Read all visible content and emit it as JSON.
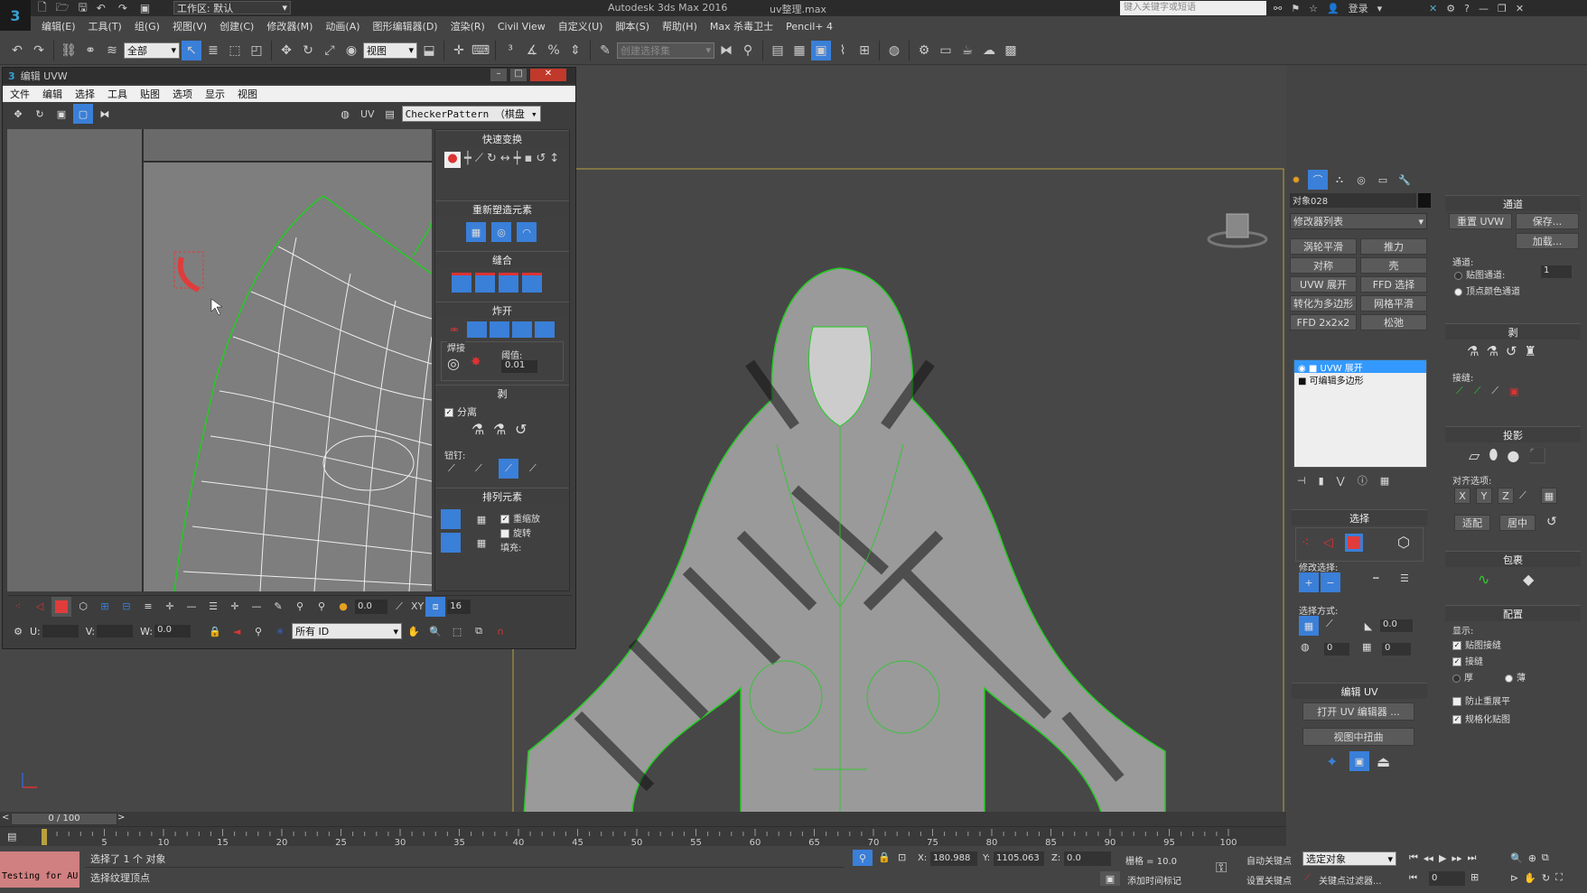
{
  "title_bar": {
    "workspace": "工作区: 默认",
    "app_title": "Autodesk 3ds Max 2016",
    "file_name": "uv整理.max",
    "search_placeholder": "键入关键字或短语",
    "login": "登录"
  },
  "main_menu": [
    "编辑(E)",
    "工具(T)",
    "组(G)",
    "视图(V)",
    "创建(C)",
    "修改器(M)",
    "动画(A)",
    "图形编辑器(D)",
    "渲染(R)",
    "Civil View",
    "自定义(U)",
    "脚本(S)",
    "帮助(H)",
    "Max 杀毒卫士",
    "Pencil+ 4"
  ],
  "toolbar": {
    "filter": "全部",
    "ref_coord": "视图",
    "selection_set": "创建选择集"
  },
  "uvw_editor": {
    "title": "编辑 UVW",
    "menu": [
      "文件",
      "编辑",
      "选择",
      "工具",
      "贴图",
      "选项",
      "显示",
      "视图"
    ],
    "uv_label": "UV",
    "texture": "CheckerPattern （棋盘",
    "rollouts": {
      "quick_transform": "快速变换",
      "reshape": "重新塑造元素",
      "stitch": "缝合",
      "explode": "炸开",
      "weld": "焊接",
      "threshold_label": "阈值:",
      "threshold": "0.01",
      "peel": "剥",
      "detach": "分离",
      "pin": "钮钉:",
      "arrange": "排列元素",
      "rescale": "重缩放",
      "rotate": "旋转",
      "padding": "填充:"
    },
    "bottom": {
      "value1": "0.0",
      "xy": "XY",
      "num": "16",
      "u_label": "U:",
      "v_label": "V:",
      "w_label": "W:",
      "w_value": "0.0",
      "id_filter": "所有 ID"
    }
  },
  "command_panel": {
    "object_name": "对象028",
    "modifier_list": "修改器列表",
    "modifier_buttons": [
      "涡轮平滑",
      "推力",
      "对称",
      "壳",
      "UVW 展开",
      "FFD 选择",
      "转化为多边形",
      "网格平滑",
      "FFD 2x2x2",
      "松弛"
    ],
    "stack": [
      "UVW 展开",
      "可编辑多边形"
    ],
    "select_header": "选择",
    "modify_select": "修改选择:",
    "select_by": "选择方式:",
    "select_val1": "0.0",
    "select_val2": "0",
    "select_val3": "0",
    "edit_uv_header": "编辑 UV",
    "open_uv_editor": "打开 UV 编辑器 ...",
    "tweak_in_view": "视图中扭曲"
  },
  "channel_panel": {
    "channel_header": "通道",
    "reset_uvw": "重置 UVW",
    "save": "保存...",
    "load": "加载...",
    "channel_label": "通道:",
    "map_channel": "贴图通道:",
    "map_channel_val": "1",
    "vertex_color": "顶点颜色通道",
    "peel_header": "剥",
    "seams": "接缝:",
    "projection_header": "投影",
    "align_options": "对齐选项:",
    "fit": "适配",
    "center": "居中",
    "wrap_header": "包裹",
    "config_header": "配置",
    "display": "显示:",
    "map_seams": "贴图接缝",
    "peel_seams": "接缝",
    "thick": "厚",
    "thin": "薄",
    "prevent_flatten": "防止重展平",
    "normalize": "规格化贴图"
  },
  "timeline": {
    "frame": "0 / 100",
    "ticks": [
      "5",
      "10",
      "15",
      "20",
      "25",
      "30",
      "35",
      "40",
      "45",
      "50",
      "55",
      "60",
      "65",
      "70",
      "75",
      "80",
      "85",
      "90",
      "95",
      "100"
    ]
  },
  "status": {
    "testing": "Testing for AU",
    "selected": "选择了 1 个 对象",
    "hint": "选择纹理顶点",
    "x_label": "X:",
    "x_val": "180.988",
    "y_label": "Y:",
    "y_val": "1105.063",
    "z_label": "Z:",
    "z_val": "0.0",
    "grid": "栅格 = 10.0",
    "add_time_tag": "添加时间标记",
    "auto_key": "自动关键点",
    "set_key": "设置关键点",
    "selected_obj": "选定对象",
    "key_filter": "关键点过滤器...",
    "frame_val": "0"
  },
  "colors": {
    "accent": "#3a7fd8",
    "selection": "#3399ff",
    "wire": "#22cc22",
    "red": "#e03c3c"
  }
}
